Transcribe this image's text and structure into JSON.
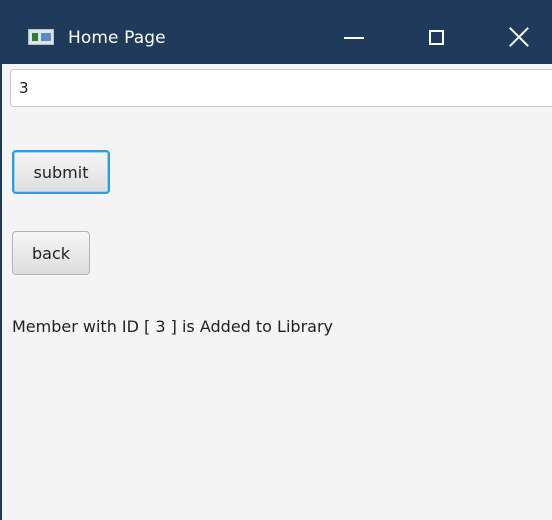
{
  "window": {
    "title": "Home Page",
    "icon": "java-window-icon",
    "controls": [
      "minimize-icon",
      "maximize-icon",
      "close-icon"
    ],
    "titlebar_color": "#1f3a5a"
  },
  "form": {
    "member_id_value": "3",
    "submit_label": "submit",
    "back_label": "back",
    "focus_color": "#2b9ddf"
  },
  "status": {
    "message": "Member with ID [ 3 ] is Added to Library"
  }
}
